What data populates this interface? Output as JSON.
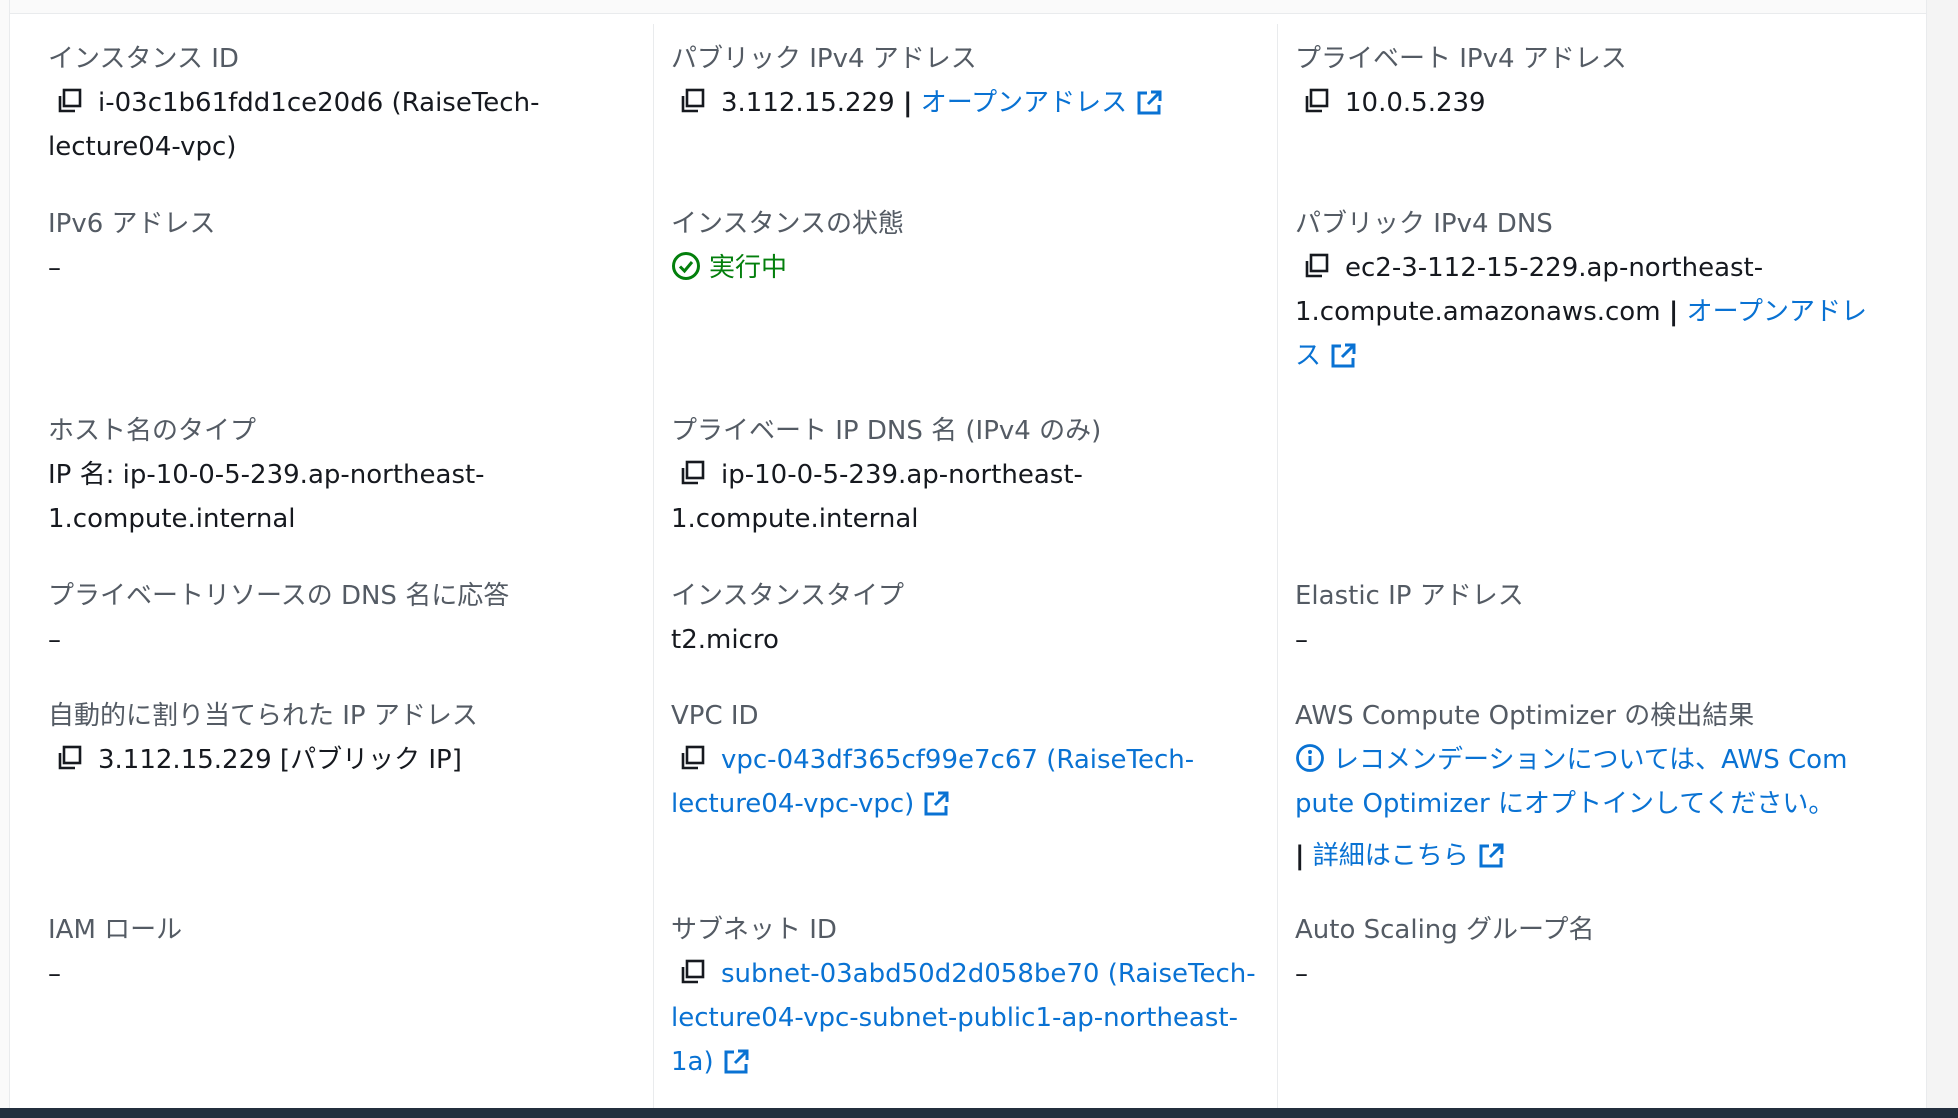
{
  "fields": {
    "instance_id": {
      "label": "インスタンス ID",
      "line1": "i-03c1b61fdd1ce20d6 (RaiseTech-",
      "line2": "lecture04-vpc)"
    },
    "public_ipv4": {
      "label": "パブリック IPv4 アドレス",
      "value": "3.112.15.229",
      "separator": "|",
      "link": "オープンアドレス"
    },
    "private_ipv4": {
      "label": "プライベート IPv4 アドレス",
      "value": "10.0.5.239"
    },
    "ipv6": {
      "label": "IPv6 アドレス",
      "value": "–"
    },
    "instance_state": {
      "label": "インスタンスの状態",
      "value": "実行中"
    },
    "public_dns": {
      "label": "パブリック IPv4 DNS",
      "line1": "ec2-3-112-15-229.ap-northeast-",
      "line2": "1.compute.amazonaws.com",
      "separator": "|",
      "link_part1": "オープンアドレ",
      "link_part2": "ス"
    },
    "hostname_type": {
      "label": "ホスト名のタイプ",
      "line1": "IP 名: ip-10-0-5-239.ap-northeast-",
      "line2": "1.compute.internal"
    },
    "private_dns": {
      "label": "プライベート IP DNS 名 (IPv4 のみ)",
      "line1": "ip-10-0-5-239.ap-northeast-",
      "line2": "1.compute.internal"
    },
    "private_resource_dns": {
      "label": "プライベートリソースの DNS 名に応答",
      "value": "–"
    },
    "instance_type": {
      "label": "インスタンスタイプ",
      "value": "t2.micro"
    },
    "elastic_ip": {
      "label": "Elastic IP アドレス",
      "value": "–"
    },
    "auto_ip": {
      "label": "自動的に割り当てられた IP アドレス",
      "value": "3.112.15.229 [パブリック IP]"
    },
    "vpc_id": {
      "label": "VPC ID",
      "line1": "vpc-043df365cf99e7c67 (RaiseTech-",
      "line2": "lecture04-vpc-vpc)"
    },
    "compute_optimizer": {
      "label": "AWS Compute Optimizer の検出結果",
      "line1": "レコメンデーションについては、AWS Com",
      "line2": "pute Optimizer にオプトインしてください。",
      "separator": "|",
      "link": "詳細はこちら"
    },
    "iam_role": {
      "label": "IAM ロール",
      "value": "–"
    },
    "subnet_id": {
      "label": "サブネット ID",
      "line1": "subnet-03abd50d2d058be70 (RaiseTech-",
      "line2": "lecture04-vpc-subnet-public1-ap-northeast-",
      "line3": "1a)"
    },
    "asg_name": {
      "label": "Auto Scaling グループ名",
      "value": "–"
    }
  },
  "colors": {
    "label": "#545b64",
    "text": "#16191f",
    "link": "#0972d3",
    "success": "#037f0c",
    "divider": "#e9ebed"
  },
  "icons": [
    "copy-icon",
    "external-link-icon",
    "status-ok-icon",
    "info-icon"
  ]
}
